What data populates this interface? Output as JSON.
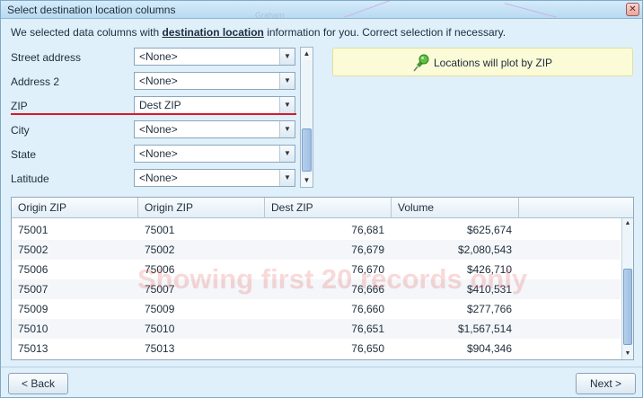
{
  "window": {
    "title": "Select destination location columns",
    "close_glyph": "✕",
    "background_map_label": "Graham"
  },
  "intro": {
    "prefix": "We selected data columns with ",
    "emphasis": "destination location",
    "suffix": " information for you. Correct selection if necessary."
  },
  "fields": [
    {
      "label": "Street address",
      "value": "<None>"
    },
    {
      "label": "Address 2",
      "value": "<None>"
    },
    {
      "label": "ZIP",
      "value": "Dest ZIP"
    },
    {
      "label": "City",
      "value": "<None>"
    },
    {
      "label": "State",
      "value": "<None>"
    },
    {
      "label": "Latitude",
      "value": "<None>"
    }
  ],
  "info": {
    "icon": "pushpin-icon",
    "text": "Locations will plot by ZIP"
  },
  "table": {
    "columns": [
      "Origin ZIP",
      "Origin ZIP",
      "Dest ZIP",
      "Volume"
    ],
    "rows": [
      [
        "75001",
        "75001",
        "76,681",
        "$625,674"
      ],
      [
        "75002",
        "75002",
        "76,679",
        "$2,080,543"
      ],
      [
        "75006",
        "75006",
        "76,670",
        "$426,710"
      ],
      [
        "75007",
        "75007",
        "76,666",
        "$410,531"
      ],
      [
        "75009",
        "75009",
        "76,660",
        "$277,766"
      ],
      [
        "75010",
        "75010",
        "76,651",
        "$1,567,514"
      ],
      [
        "75013",
        "75013",
        "76,650",
        "$904,346"
      ]
    ],
    "watermark": "Showing first 20 records only"
  },
  "buttons": {
    "back": "< Back",
    "next": "Next >"
  },
  "colors": {
    "highlight_underline": "#d9182b",
    "dialog_background": "#dff0fb",
    "info_background": "#fbfbd8"
  }
}
